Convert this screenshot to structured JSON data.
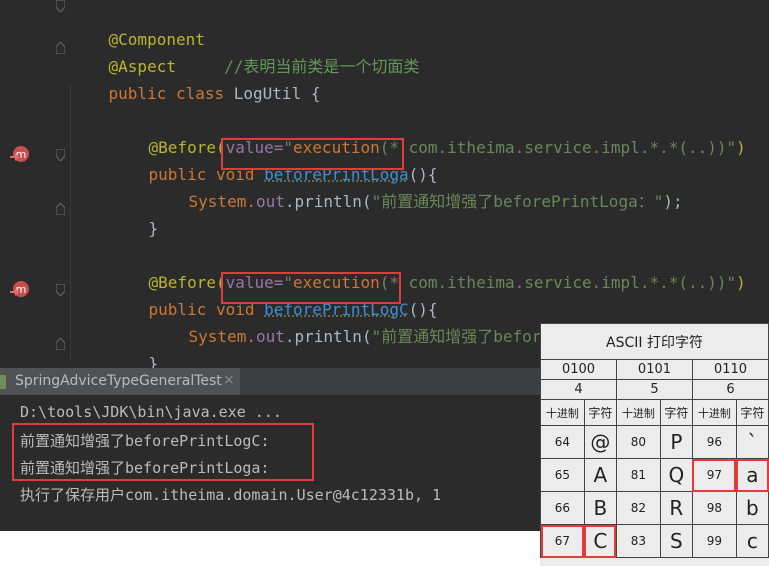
{
  "editor": {
    "lines": {
      "component": "@Component",
      "aspect_ann": "@Aspect",
      "aspect_comment": "//表明当前类是一个切面类",
      "class_kw": "public class",
      "class_name": "LogUtil",
      "brace_open": "{",
      "before_ann": "@Before(",
      "before_value": "value=",
      "before_expr_open": "\"",
      "before_fn": "execution",
      "before_expr_rest": "(* com.itheima.service.impl.*.*(..))\"",
      "before_close": ")",
      "m1_kw": "public void",
      "m1_name": "beforePrintLoga",
      "m1_tail": "(){",
      "m1_sys": "System.",
      "m1_out": "out",
      "m1_println": ".println(",
      "m1_str": "\"前置通知增强了beforePrintLoga：\"",
      "m1_end": ");",
      "close_brace": "}",
      "m2_kw": "public void",
      "m2_name": "beforePrintLogC",
      "m2_tail": "(){",
      "m2_str": "\"前置通知增强了beforePrintLogC：\"",
      "m2_end": ");"
    },
    "colors": {
      "background": "#2b2b2b",
      "annotation": "#bbb529",
      "keyword": "#cc7832",
      "string": "#6a8759",
      "comment": "#629755",
      "highlight_box": "#e03c3c"
    },
    "gutter_icons": [
      "method-override-icon",
      "method-override-icon"
    ]
  },
  "console": {
    "tab_label": "SpringAdviceTypeGeneralTest",
    "tab_close": "×",
    "lines": [
      "D:\\tools\\JDK\\bin\\java.exe ...",
      "前置通知增强了beforePrintLogC:",
      "前置通知增强了beforePrintLoga:",
      "执行了保存用户com.itheima.domain.User@4c12331b, 1"
    ]
  },
  "ascii_table": {
    "title": "ASCII 打印字符",
    "groups": [
      {
        "bits": "0100",
        "num": "4"
      },
      {
        "bits": "0101",
        "num": "5"
      },
      {
        "bits": "0110",
        "num": "6"
      }
    ],
    "col_headers": [
      "十进制",
      "字符",
      "十进制",
      "字符",
      "十进制",
      "字符"
    ],
    "rows": [
      [
        "64",
        "@",
        "80",
        "P",
        "96",
        "`"
      ],
      [
        "65",
        "A",
        "81",
        "Q",
        "97",
        "a"
      ],
      [
        "66",
        "B",
        "82",
        "R",
        "98",
        "b"
      ],
      [
        "67",
        "C",
        "83",
        "S",
        "99",
        "c"
      ]
    ]
  }
}
